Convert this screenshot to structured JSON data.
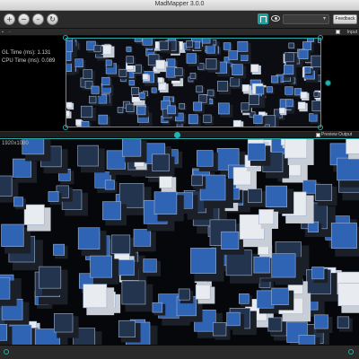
{
  "window": {
    "title": "MadMapper 3.0.0"
  },
  "toolbar": {
    "feedback_label": "Feedback",
    "dropdown_value": ""
  },
  "input_panel": {
    "label": "Input",
    "gl_time": "GL Time (ms): 1.131",
    "cpu_time": "CPU Time (ms): 0.089"
  },
  "output_panel": {
    "preview_label": "Preview Output",
    "resolution": "1920x1080"
  },
  "colors": {
    "accent": "#1fb5b5",
    "cube_blue": "#2f63b4",
    "cube_dark": "#1b1f28",
    "background": "#000000"
  }
}
